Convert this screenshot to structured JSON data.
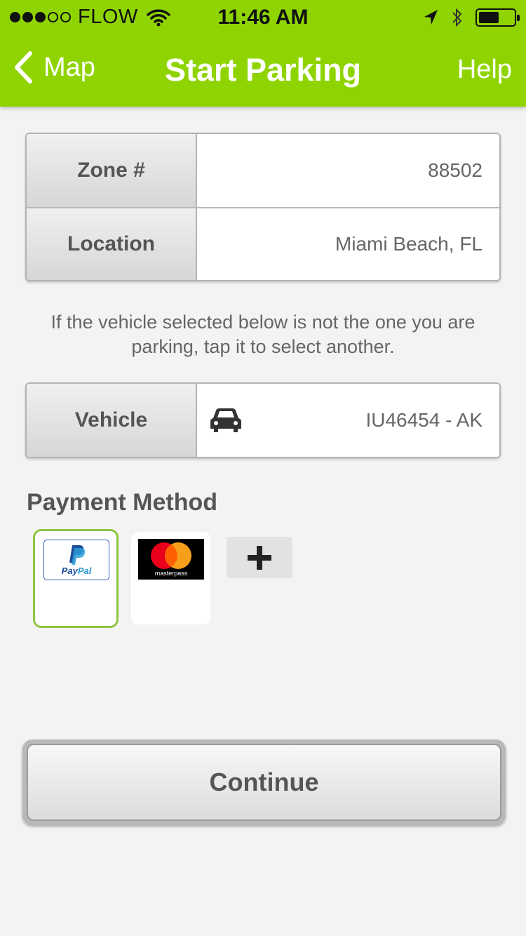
{
  "status_bar": {
    "carrier": "FLOW",
    "time": "11:46 AM",
    "signal_bars_filled": 3,
    "signal_bars_total": 5,
    "battery_level": 0.58
  },
  "nav": {
    "back_label": "Map",
    "title": "Start Parking",
    "help_label": "Help"
  },
  "parking": {
    "zone_label": "Zone #",
    "zone_value": "88502",
    "location_label": "Location",
    "location_value": "Miami Beach, FL"
  },
  "hint": "If the vehicle selected below is not the one you are parking, tap it to select another.",
  "vehicle": {
    "label": "Vehicle",
    "value": "IU46454 - AK",
    "icon": "car-icon"
  },
  "payment": {
    "heading": "Payment Method",
    "options": [
      {
        "name": "PayPal",
        "logo_text_1": "Pay",
        "logo_text_2": "Pal",
        "selected": true
      },
      {
        "name": "masterpass",
        "logo_text": "masterpass",
        "selected": false
      }
    ],
    "add_icon": "plus-icon"
  },
  "continue_label": "Continue",
  "colors": {
    "header_green": "#8fd400",
    "selected_border": "#8dc63f",
    "paypal_blue": "#1d4e9a",
    "mastercard_red": "#eb001b",
    "mastercard_orange": "#f79e1b"
  }
}
